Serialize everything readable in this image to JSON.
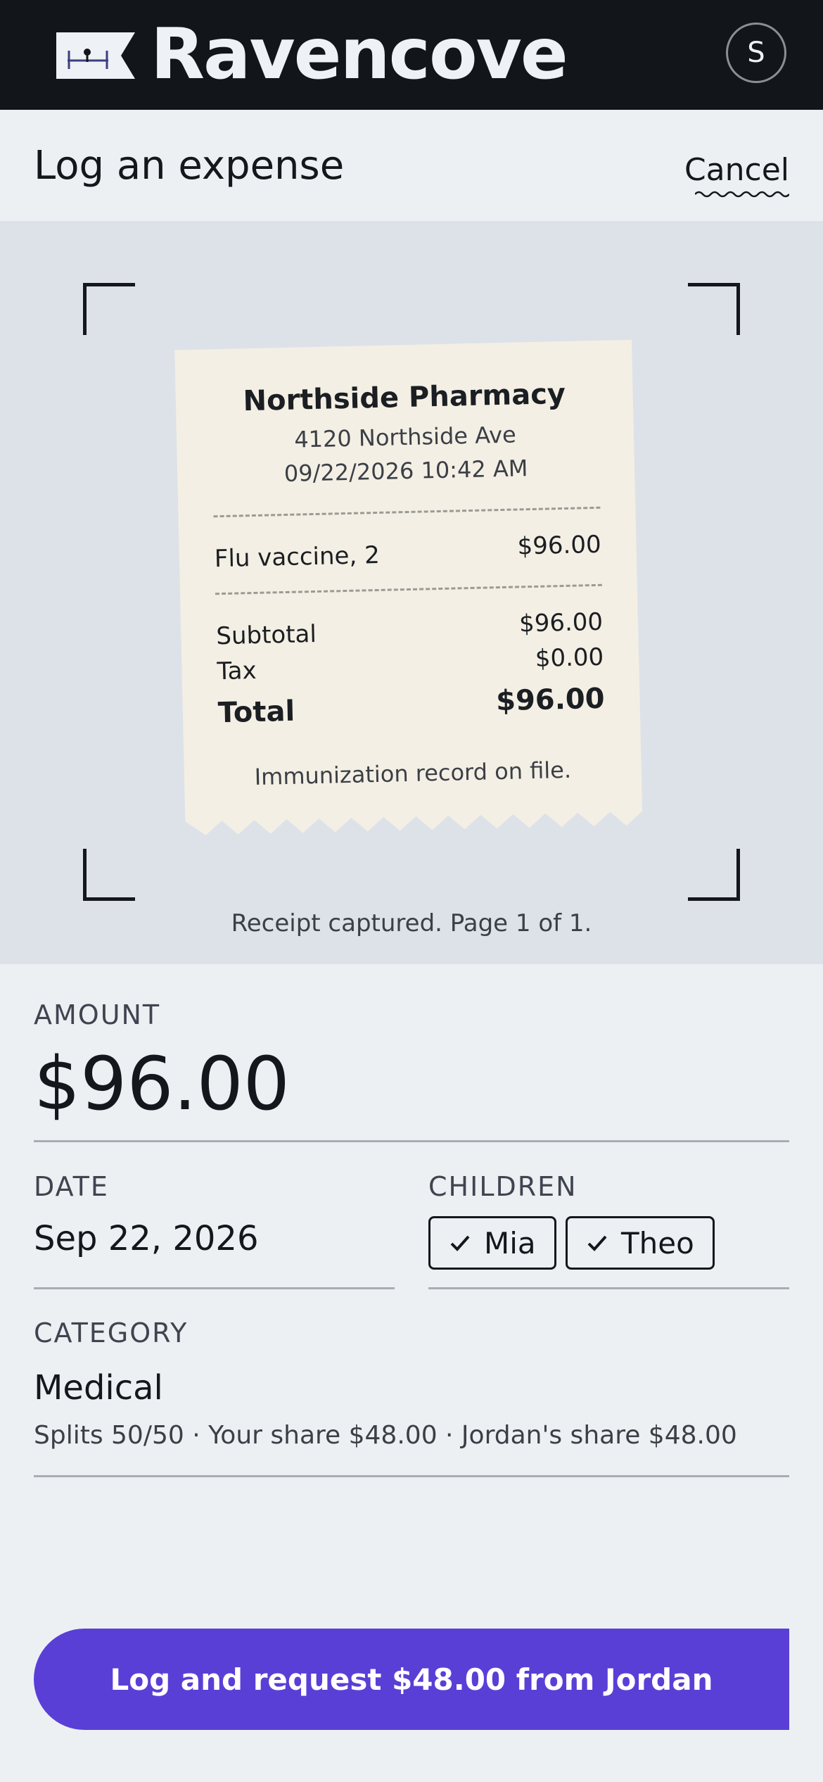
{
  "header": {
    "brand": "Ravencove",
    "avatar_initial": "S"
  },
  "titlebar": {
    "title": "Log an expense",
    "cancel_label": "Cancel"
  },
  "receipt": {
    "merchant": "Northside Pharmacy",
    "address": "4120 Northside Ave",
    "datetime": "09/22/2026 10:42 AM",
    "line_item": {
      "label": "Flu vaccine, 2",
      "amount": "$96.00"
    },
    "subtotal": {
      "label": "Subtotal",
      "amount": "$96.00"
    },
    "tax": {
      "label": "Tax",
      "amount": "$0.00"
    },
    "total": {
      "label": "Total",
      "amount": "$96.00"
    },
    "note": "Immunization record on file."
  },
  "scan_status": "Receipt captured. Page 1 of 1.",
  "form": {
    "amount_label": "AMOUNT",
    "amount_value": "$96.00",
    "date_label": "DATE",
    "date_value": "Sep 22, 2026",
    "children_label": "CHILDREN",
    "children": [
      "Mia",
      "Theo"
    ],
    "category_label": "CATEGORY",
    "category_value": "Medical",
    "split_note": "Splits 50/50 · Your share $48.00 · Jordan's share $48.00"
  },
  "cta_label": "Log and request $48.00 from Jordan",
  "colors": {
    "accent": "#5a3fd6",
    "header_bg": "#121519",
    "receipt_paper": "#f4efe4"
  }
}
